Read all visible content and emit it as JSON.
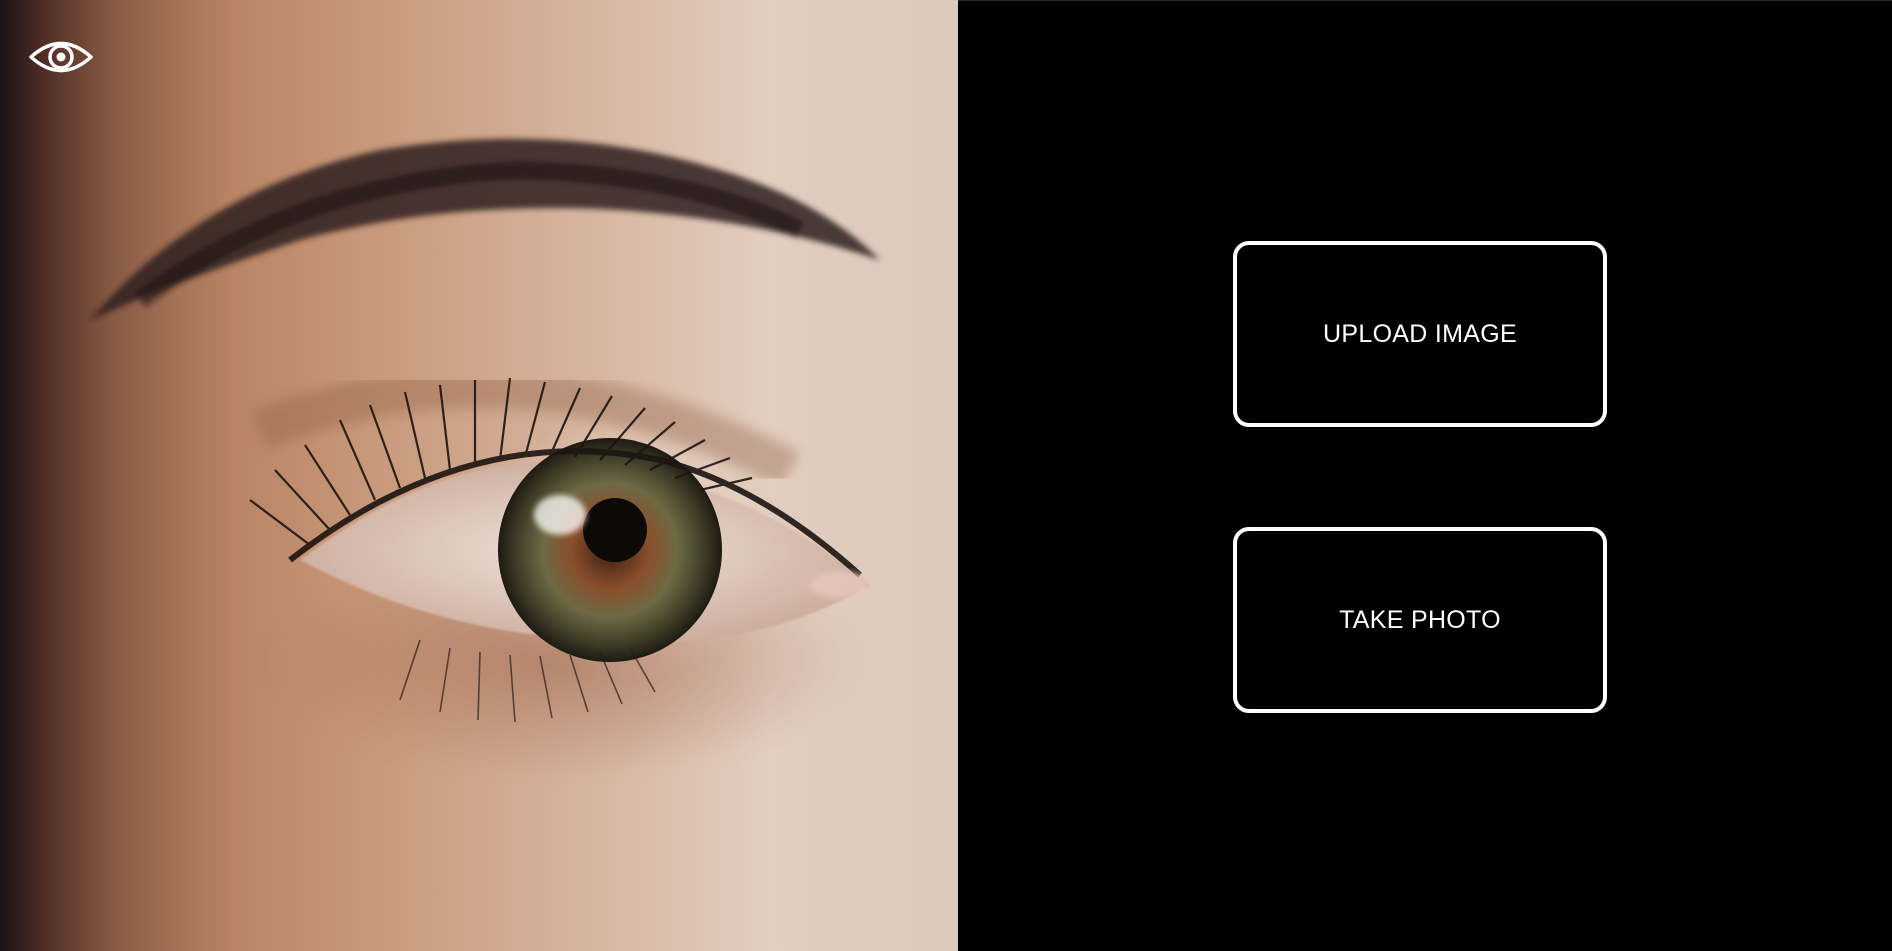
{
  "header": {
    "logo_icon": "eye-icon"
  },
  "hero": {
    "image_subject": "close-up of a human eye"
  },
  "actions": {
    "upload_label": "UPLOAD IMAGE",
    "take_photo_label": "TAKE PHOTO"
  },
  "colors": {
    "background": "#000000",
    "button_border": "#ffffff",
    "button_text": "#ffffff"
  }
}
